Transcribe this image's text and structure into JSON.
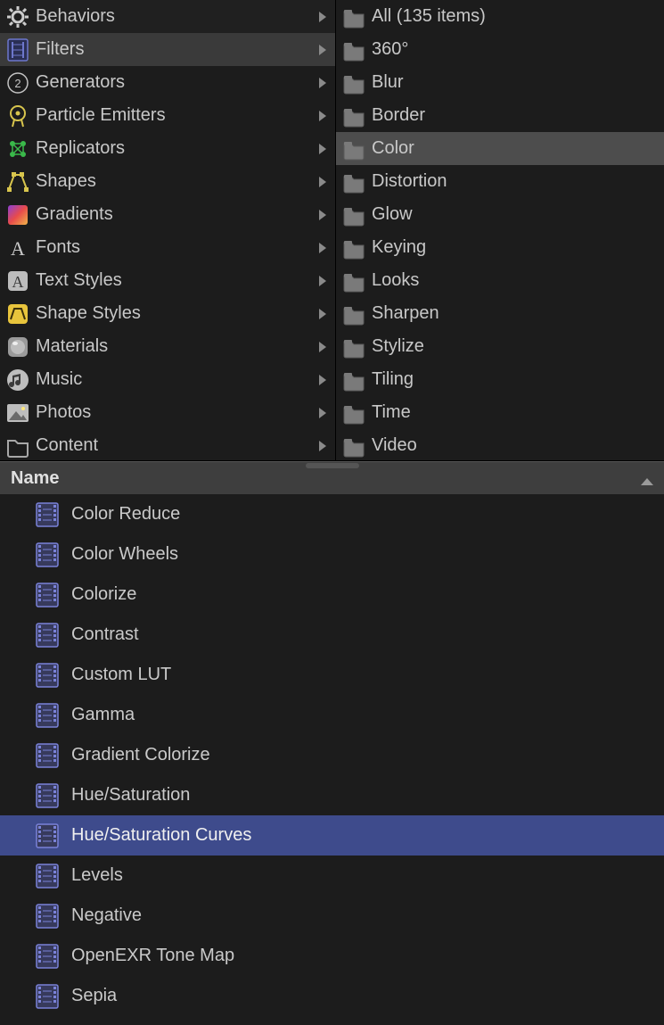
{
  "left_categories": [
    {
      "label": "Behaviors",
      "icon": "gear"
    },
    {
      "label": "Filters",
      "icon": "filter",
      "selected": true
    },
    {
      "label": "Generators",
      "icon": "generator"
    },
    {
      "label": "Particle Emitters",
      "icon": "emitter"
    },
    {
      "label": "Replicators",
      "icon": "replicator"
    },
    {
      "label": "Shapes",
      "icon": "shapetool"
    },
    {
      "label": "Gradients",
      "icon": "gradient"
    },
    {
      "label": "Fonts",
      "icon": "font"
    },
    {
      "label": "Text Styles",
      "icon": "textstyle"
    },
    {
      "label": "Shape Styles",
      "icon": "shapestyle"
    },
    {
      "label": "Materials",
      "icon": "material"
    },
    {
      "label": "Music",
      "icon": "music"
    },
    {
      "label": "Photos",
      "icon": "photo"
    },
    {
      "label": "Content",
      "icon": "folder"
    }
  ],
  "right_folders": [
    {
      "label": "All (135 items)"
    },
    {
      "label": "360°"
    },
    {
      "label": "Blur"
    },
    {
      "label": "Border"
    },
    {
      "label": "Color",
      "selected": true
    },
    {
      "label": "Distortion"
    },
    {
      "label": "Glow"
    },
    {
      "label": "Keying"
    },
    {
      "label": "Looks"
    },
    {
      "label": "Sharpen"
    },
    {
      "label": "Stylize"
    },
    {
      "label": "Tiling"
    },
    {
      "label": "Time"
    },
    {
      "label": "Video"
    }
  ],
  "name_header": {
    "label": "Name"
  },
  "items": [
    {
      "label": "Color Reduce"
    },
    {
      "label": "Color Wheels"
    },
    {
      "label": "Colorize"
    },
    {
      "label": "Contrast"
    },
    {
      "label": "Custom LUT"
    },
    {
      "label": "Gamma"
    },
    {
      "label": "Gradient Colorize"
    },
    {
      "label": "Hue/Saturation"
    },
    {
      "label": "Hue/Saturation Curves",
      "selected": true
    },
    {
      "label": "Levels"
    },
    {
      "label": "Negative"
    },
    {
      "label": "OpenEXR Tone Map"
    },
    {
      "label": "Sepia"
    }
  ]
}
